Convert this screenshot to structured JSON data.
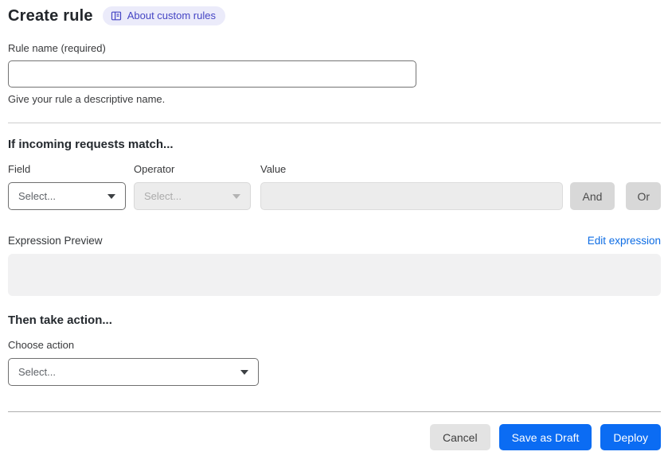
{
  "colors": {
    "primary_blue": "#0b6cf3",
    "link_blue": "#0d6ce4",
    "badge_bg": "#ebebfa",
    "badge_text": "#4545c4",
    "disabled_bg": "#ececec",
    "neutral_button_bg": "#d8d8d8"
  },
  "header": {
    "title": "Create rule",
    "about_link_label": "About custom rules"
  },
  "rule_name": {
    "label": "Rule name (required)",
    "value": "",
    "helper": "Give your rule a descriptive name."
  },
  "match_section": {
    "heading": "If incoming requests match...",
    "field": {
      "label": "Field",
      "selected": "Select...",
      "state": "enabled"
    },
    "operator": {
      "label": "Operator",
      "selected": "Select...",
      "state": "disabled"
    },
    "value": {
      "label": "Value",
      "value": "",
      "state": "disabled"
    },
    "and_button": "And",
    "or_button": "Or"
  },
  "expression_preview": {
    "label": "Expression Preview",
    "edit_link": "Edit expression",
    "content": ""
  },
  "action_section": {
    "heading": "Then take action...",
    "choose_label": "Choose action",
    "selected": "Select..."
  },
  "footer": {
    "cancel": "Cancel",
    "save_draft": "Save as Draft",
    "deploy": "Deploy"
  }
}
